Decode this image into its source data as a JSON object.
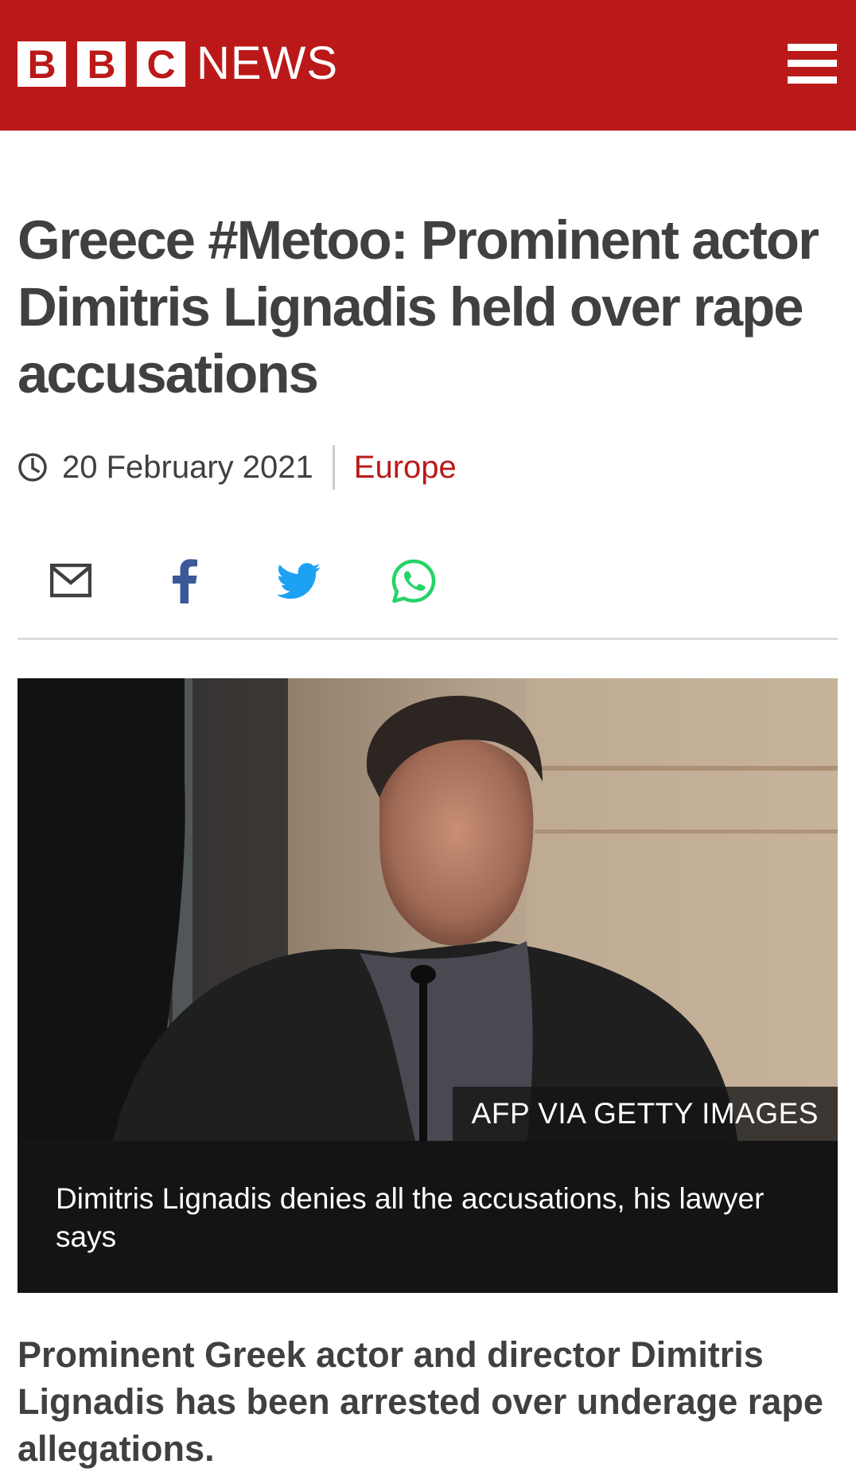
{
  "header": {
    "logo_letters": [
      "B",
      "B",
      "C"
    ],
    "logo_word": "NEWS",
    "brand_color": "#bb1919",
    "menu_icon": "hamburger-menu-icon"
  },
  "article": {
    "headline": "Greece #Metoo: Prominent actor Dimitris Lignadis held over rape accusations",
    "date": "20 February 2021",
    "section": "Europe",
    "share": [
      {
        "name": "email",
        "icon": "email-icon",
        "color": "#404040"
      },
      {
        "name": "facebook",
        "icon": "facebook-icon",
        "color": "#3b5998"
      },
      {
        "name": "twitter",
        "icon": "twitter-icon",
        "color": "#1da1f2"
      },
      {
        "name": "whatsapp",
        "icon": "whatsapp-icon",
        "color": "#25d366"
      }
    ],
    "image": {
      "credit": "AFP VIA GETTY IMAGES",
      "caption": "Dimitris Lignadis denies all the accusations, his lawyer says"
    },
    "intro": "Prominent Greek actor and director Dimitris Lignadis has been arrested over underage rape allegations."
  }
}
